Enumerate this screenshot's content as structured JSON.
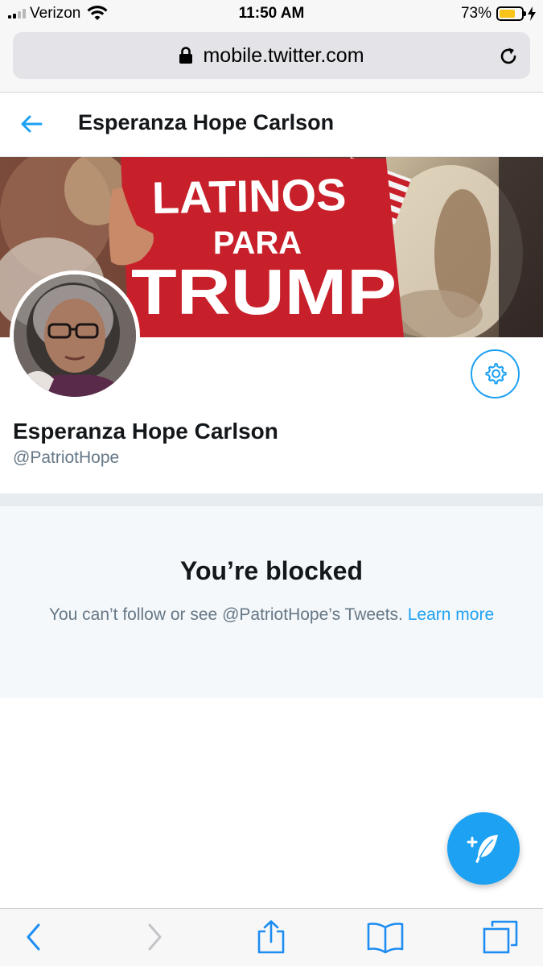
{
  "status_bar": {
    "carrier": "Verizon",
    "time": "11:50 AM",
    "battery_percent": "73%",
    "battery_level": 0.73,
    "signal_bars": 4,
    "signal_bars_filled": 2,
    "battery_color": "#f8c41a"
  },
  "browser": {
    "url": "mobile.twitter.com",
    "lock_icon": "lock-icon",
    "reload_icon": "reload-icon"
  },
  "header": {
    "title": "Esperanza Hope Carlson",
    "back_icon": "arrow-left-icon"
  },
  "banner": {
    "sign_line_1": "LATINOS",
    "sign_line_2": "PARA",
    "sign_line_3": "TRUMP",
    "sign_color": "#c8202a"
  },
  "profile": {
    "name": "Esperanza Hope Carlson",
    "handle": "@PatriotHope",
    "settings_icon": "gear-icon"
  },
  "blocked": {
    "title": "You’re blocked",
    "message": "You can’t follow or see @PatriotHope’s Tweets.",
    "learn_more": "Learn more"
  },
  "fab": {
    "icon": "compose-tweet-icon"
  },
  "toolbar": {
    "icons": [
      "chevron-left-icon",
      "chevron-right-icon",
      "share-icon",
      "bookmarks-icon",
      "tabs-icon"
    ]
  },
  "colors": {
    "accent": "#1da1f2",
    "text_primary": "#14171a",
    "text_secondary": "#657786",
    "panel_bg": "#f5f8fa"
  }
}
